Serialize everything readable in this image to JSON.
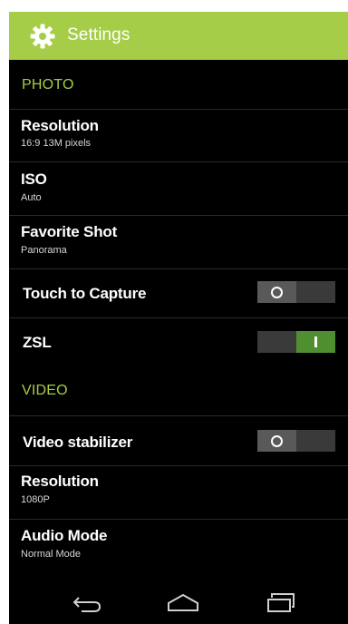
{
  "header": {
    "title": "Settings",
    "icon": "gear-icon",
    "accent_color": "#a6cd47"
  },
  "photo_section": {
    "label": "PHOTO",
    "items": [
      {
        "title": "Resolution",
        "value": "16:9 13M pixels"
      },
      {
        "title": "ISO",
        "value": "Auto"
      },
      {
        "title": "Favorite Shot",
        "value": "Panorama"
      }
    ],
    "toggles": [
      {
        "title": "Touch to Capture",
        "state": "off"
      },
      {
        "title": "ZSL",
        "state": "on"
      }
    ]
  },
  "video_section": {
    "label": "VIDEO",
    "toggles": [
      {
        "title": "Video stabilizer",
        "state": "off"
      }
    ],
    "items": [
      {
        "title": "Resolution",
        "value": "1080P"
      },
      {
        "title": "Audio Mode",
        "value": "Normal Mode"
      }
    ]
  },
  "navbar": {
    "icons": [
      "back-icon",
      "home-icon",
      "recent-apps-icon"
    ]
  }
}
